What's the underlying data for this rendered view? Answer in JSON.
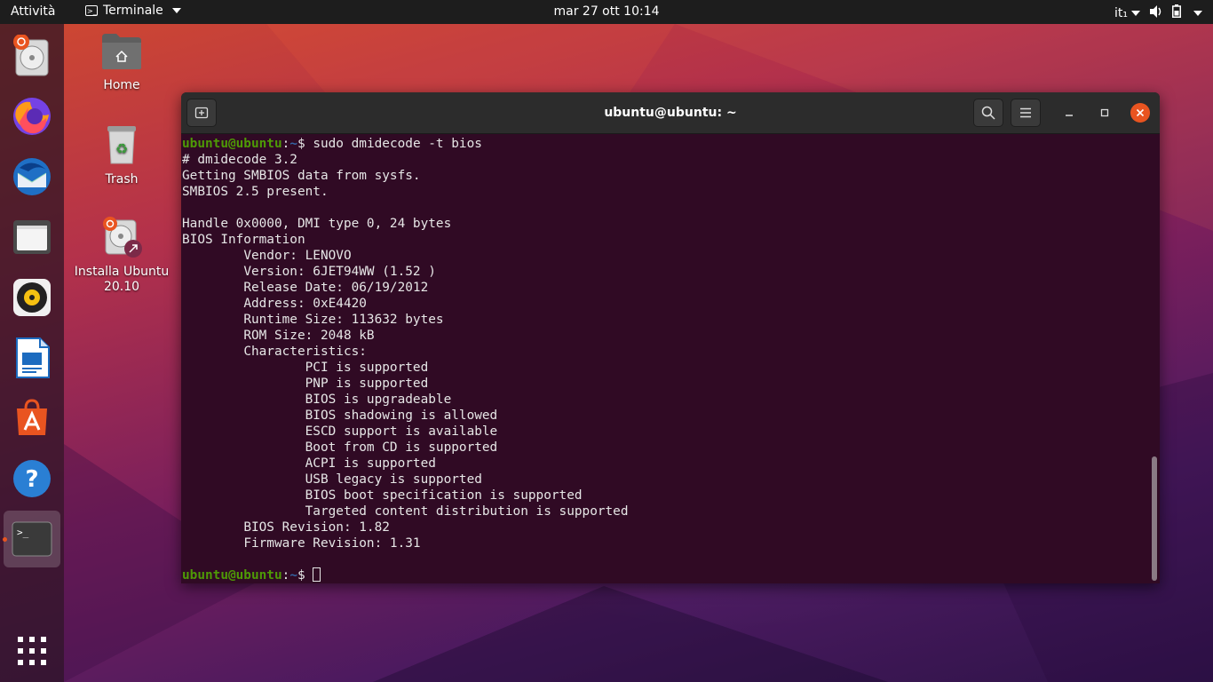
{
  "topbar": {
    "activities": "Attività",
    "app_menu_label": "Terminale",
    "clock": "mar 27 ott  10:14",
    "keyboard_layout": "it₁"
  },
  "dock": {
    "items": [
      {
        "name": "Installa Ubuntu 20.10",
        "icon": "disk-installer-icon"
      },
      {
        "name": "Firefox",
        "icon": "firefox-icon"
      },
      {
        "name": "Thunderbird",
        "icon": "thunderbird-icon"
      },
      {
        "name": "File",
        "icon": "files-icon"
      },
      {
        "name": "Rhythmbox",
        "icon": "rhythmbox-icon"
      },
      {
        "name": "LibreOffice Writer",
        "icon": "writer-icon"
      },
      {
        "name": "Ubuntu Software",
        "icon": "software-icon"
      },
      {
        "name": "Aiuto",
        "icon": "help-icon"
      },
      {
        "name": "Terminale",
        "icon": "terminal-icon",
        "active": true
      }
    ],
    "show_apps_icon": "grid-icon"
  },
  "desktop": {
    "home_label": "Home",
    "trash_label": "Trash",
    "installer_label_1": "Installa Ubuntu",
    "installer_label_2": "20.10"
  },
  "terminal": {
    "title": "ubuntu@ubuntu: ~",
    "prompt_user": "ubuntu@ubuntu",
    "prompt_sep": ":",
    "prompt_path": "~",
    "prompt_end": "$ ",
    "command": "sudo dmidecode -t bios",
    "output": "# dmidecode 3.2\nGetting SMBIOS data from sysfs.\nSMBIOS 2.5 present.\n\nHandle 0x0000, DMI type 0, 24 bytes\nBIOS Information\n\tVendor: LENOVO\n\tVersion: 6JET94WW (1.52 )\n\tRelease Date: 06/19/2012\n\tAddress: 0xE4420\n\tRuntime Size: 113632 bytes\n\tROM Size: 2048 kB\n\tCharacteristics:\n\t\tPCI is supported\n\t\tPNP is supported\n\t\tBIOS is upgradeable\n\t\tBIOS shadowing is allowed\n\t\tESCD support is available\n\t\tBoot from CD is supported\n\t\tACPI is supported\n\t\tUSB legacy is supported\n\t\tBIOS boot specification is supported\n\t\tTargeted content distribution is supported\n\tBIOS Revision: 1.82\n\tFirmware Revision: 1.31\n"
  },
  "colors": {
    "ubuntu_orange": "#e95420",
    "terminal_bg": "#300a24",
    "prompt_green": "#4e9a06",
    "prompt_blue": "#3465a4"
  }
}
